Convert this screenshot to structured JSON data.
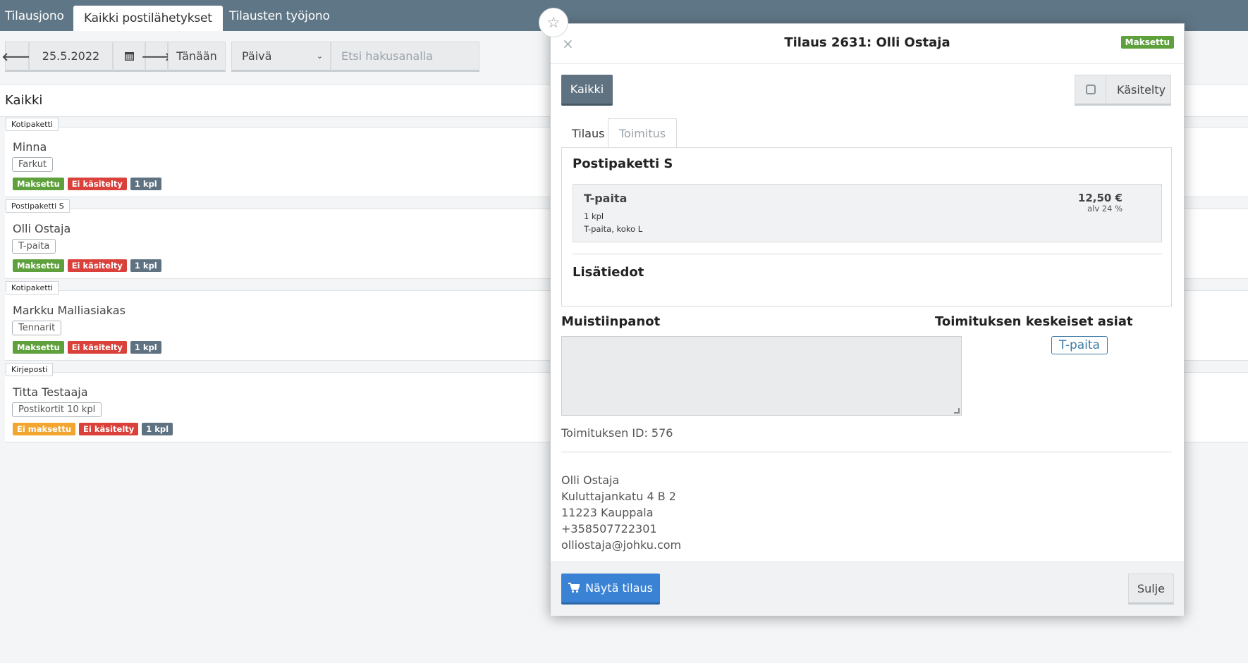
{
  "top_tabs": [
    {
      "label": "Tilausjono"
    },
    {
      "label": "Kaikki postilähetykset"
    },
    {
      "label": "Tilausten työjono"
    }
  ],
  "toolbar": {
    "date": "25.5.2022",
    "today_label": "Tänään",
    "period_select": "Päivä",
    "search_placeholder": "Etsi hakusanalla",
    "icons": {
      "prev": "arrow-left-icon",
      "calendar": "calendar-icon",
      "next": "arrow-right-icon",
      "dropdown": "chevron-down-icon"
    }
  },
  "list": {
    "heading": "Kaikki",
    "cards": [
      {
        "type": "Kotipaketti",
        "name": "Minna",
        "product": "Farkut",
        "badges": [
          "Maksettu",
          "Ei käsitelty",
          "1 kpl"
        ]
      },
      {
        "type": "Postipaketti S",
        "name": "Olli Ostaja",
        "product": "T-paita",
        "badges": [
          "Maksettu",
          "Ei käsitelty",
          "1 kpl"
        ]
      },
      {
        "type": "Kotipaketti",
        "name": "Markku Malliasiakas",
        "product": "Tennarit",
        "badges": [
          "Maksettu",
          "Ei käsitelty",
          "1 kpl"
        ]
      },
      {
        "type": "Kirjeposti",
        "name": "Titta Testaaja",
        "product": "Postikortit 10 kpl",
        "badges": [
          "Ei maksettu",
          "Ei käsitelty",
          "1 kpl"
        ]
      }
    ]
  },
  "modal": {
    "close_glyph": "×",
    "star_glyph": "☆",
    "title": "Tilaus 2631: Olli Ostaja",
    "status": "Maksettu",
    "btn_all": "Kaikki",
    "btn_processed": "Käsitelty",
    "tabs": [
      "Tilaus",
      "Toimitus"
    ],
    "shipping_method": "Postipaketti S",
    "item": {
      "name": "T-paita",
      "qty": "1 kpl",
      "desc": "T-paita, koko L",
      "price": "12,50 €",
      "vat": "alv 24 %"
    },
    "extra_heading": "Lisätiedot",
    "notes_heading": "Muistiinpanot",
    "key_heading": "Toimituksen keskeiset asiat",
    "key_tag": "T-paita",
    "shipment_id": "Toimituksen ID: 576",
    "address": [
      "Olli Ostaja",
      "Kuluttajankatu 4 B 2",
      "11223 Kauppala",
      "+358507722301",
      "olliostaja@johku.com"
    ],
    "btn_show": "Näytä tilaus",
    "btn_close": "Sulje"
  },
  "colors": {
    "topbar": "#5f7686",
    "paid": "#5ea03c",
    "unprocessed": "#d9413a",
    "qty": "#5f7282",
    "unpaid": "#f2a52f",
    "primary": "#3a82d4"
  }
}
